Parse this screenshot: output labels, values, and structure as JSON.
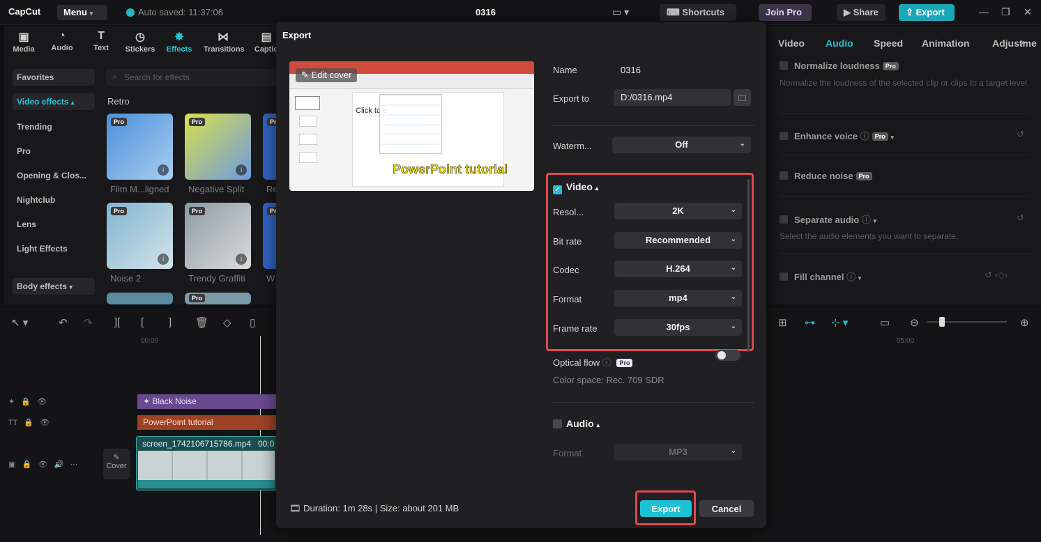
{
  "topbar": {
    "logo": "CapCut",
    "menu_label": "Menu",
    "autosave": "Auto saved: 11:37:06",
    "project_title": "0316",
    "shortcuts_label": "Shortcuts",
    "joinpro_label": "Join Pro",
    "share_label": "Share",
    "export_label": "Export"
  },
  "toolbar": [
    {
      "icon": "media-icon",
      "label": "Media"
    },
    {
      "icon": "audio-icon",
      "label": "Audio"
    },
    {
      "icon": "text-icon",
      "label": "Text"
    },
    {
      "icon": "sticker-icon",
      "label": "Stickers"
    },
    {
      "icon": "effects-icon",
      "label": "Effects"
    },
    {
      "icon": "transitions-icon",
      "label": "Transitions"
    },
    {
      "icon": "captions-icon",
      "label": "Captio"
    }
  ],
  "sidebar": {
    "items": [
      "Favorites",
      "Video effects",
      "Trending",
      "Pro",
      "Opening & Clos...",
      "Nightclub",
      "Lens",
      "Light Effects",
      "Body effects"
    ]
  },
  "search": {
    "placeholder": "Search for effects"
  },
  "effects": {
    "section": "Retro",
    "thumbs": [
      {
        "label": "Film M...ligned",
        "pro": "Pro"
      },
      {
        "label": "Negative Split",
        "pro": "Pro"
      },
      {
        "label": "Re",
        "pro": "Pro"
      },
      {
        "label": "Noise 2",
        "pro": "Pro"
      },
      {
        "label": "Trendy Graffiti",
        "pro": "Pro"
      },
      {
        "label": "W",
        "pro": "Pro"
      }
    ],
    "extra_pro": "Pro"
  },
  "rightpanel": {
    "tabs": [
      "Video",
      "Audio",
      "Speed",
      "Animation",
      "Adjustme"
    ],
    "options": [
      {
        "label": "Normalize loudness",
        "pro": "Pro",
        "desc": "Normalize the loudness of the selected clip or clips to a target level."
      },
      {
        "label": "Enhance voice",
        "pro": "Pro",
        "desc": ""
      },
      {
        "label": "Reduce noise",
        "pro": "Pro",
        "desc": ""
      },
      {
        "label": "Separate audio",
        "pro": "",
        "desc": "Select the audio elements you want to separate."
      },
      {
        "label": "Fill channel",
        "pro": "",
        "desc": ""
      }
    ]
  },
  "timeline": {
    "ruler_start": "00:00",
    "ruler_end": "05:00",
    "clips": {
      "effect": "Black Noise",
      "text": "PowerPoint tutorial",
      "video": "screen_1742106715786.mp4",
      "video_time": "00:0"
    },
    "cover_label": "Cover"
  },
  "export_dialog": {
    "title": "Export",
    "edit_cover": "Edit cover",
    "preview_caption": "PowerPoint tutorial",
    "preview_slide_text": "Click to e",
    "name_label": "Name",
    "name_value": "0316",
    "export_to_label": "Export to",
    "export_to_value": "D:/0316.mp4",
    "watermark_label": "Waterm...",
    "watermark_value": "Off",
    "video_section": "Video",
    "resolution_label": "Resol...",
    "resolution_value": "2K",
    "bitrate_label": "Bit rate",
    "bitrate_value": "Recommended",
    "codec_label": "Codec",
    "codec_value": "H.264",
    "format_label": "Format",
    "format_value": "mp4",
    "framerate_label": "Frame rate",
    "framerate_value": "30fps",
    "optical_flow_label": "Optical flow",
    "optical_flow_pro": "Pro",
    "color_space": "Color space: Rec. 709 SDR",
    "audio_section": "Audio",
    "audio_format_label": "Format",
    "audio_format_value": "MP3",
    "footer_info": "Duration: 1m 28s | Size: about 201 MB",
    "export_btn": "Export",
    "cancel_btn": "Cancel"
  },
  "colors": {
    "accent": "#1fc1d4",
    "highlight": "#e0484f",
    "modal_bg": "#202023"
  }
}
